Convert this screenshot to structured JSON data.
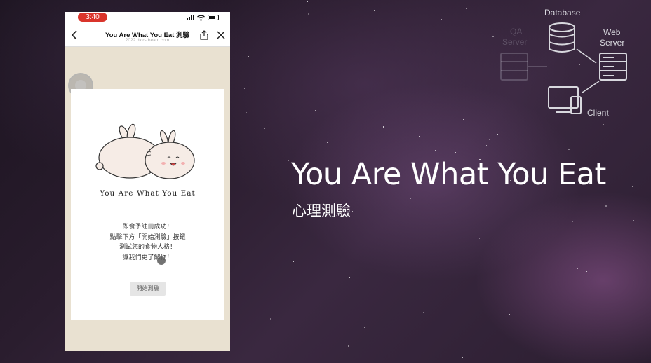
{
  "phone": {
    "status_time": "3:40",
    "nav": {
      "title": "You Are What You Eat 測驗",
      "url": "2022.dxlc-dream.com"
    },
    "card": {
      "title": "You Are What You Eat",
      "message_lines": [
        "即食予註冊成功！",
        "點擊下方「開始測驗」按鈕",
        "測試您的食物人格！",
        "讓我們更了解你！"
      ],
      "start_button": "開始測驗"
    }
  },
  "slide": {
    "title": "You Are What You Eat",
    "subtitle": "心理測驗"
  },
  "diagram": {
    "database": "Database",
    "web_server_1": "Web",
    "web_server_2": "Server",
    "qa_server_1": "QA",
    "qa_server_2": "Server",
    "client": "Client"
  },
  "colors": {
    "time_pill": "#d9342b",
    "phone_bg": "#e9e1d1",
    "slide_text": "#ffffff"
  }
}
